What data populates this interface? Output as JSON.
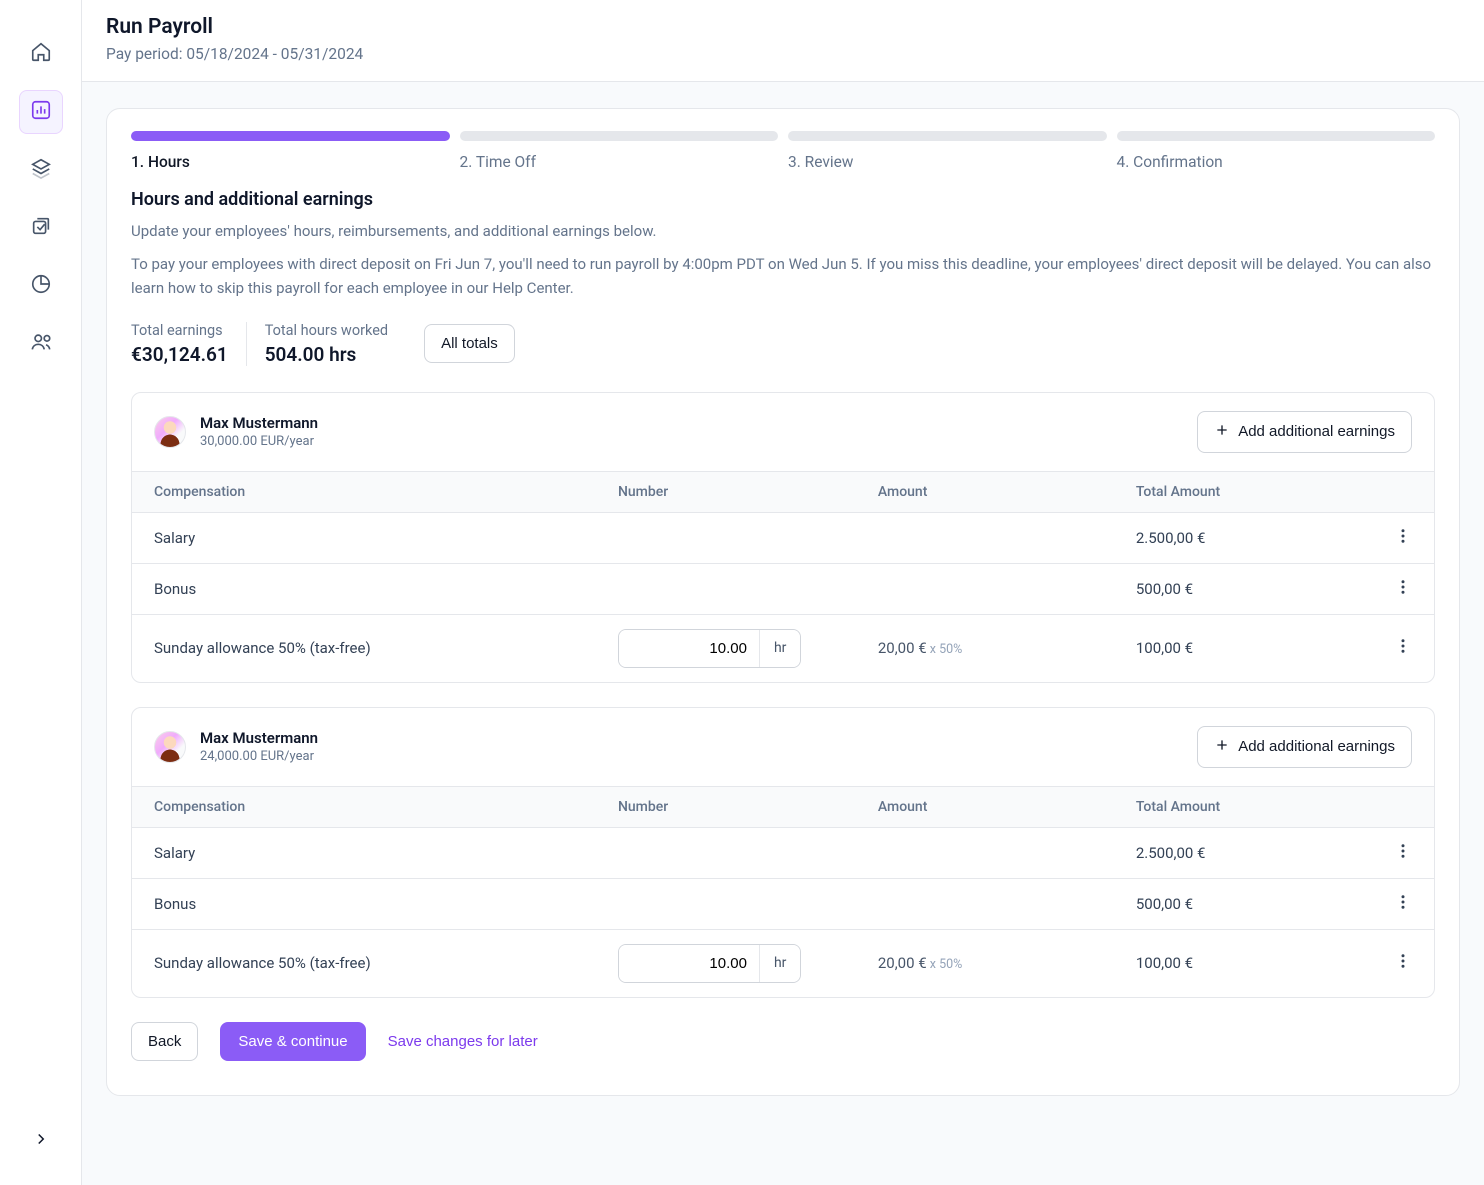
{
  "header": {
    "title": "Run Payroll",
    "subtitle": "Pay period: 05/18/2024 - 05/31/2024"
  },
  "steps": [
    {
      "label": "1. Hours",
      "active": true
    },
    {
      "label": "2. Time Off",
      "active": false
    },
    {
      "label": "3. Review",
      "active": false
    },
    {
      "label": "4. Confirmation",
      "active": false
    }
  ],
  "section": {
    "title": "Hours and additional earnings",
    "desc1": "Update your employees' hours, reimbursements, and additional earnings below.",
    "desc2": "To pay your employees with direct deposit on Fri Jun 7, you'll need to run payroll by 4:00pm PDT on Wed Jun 5. If you miss this deadline, your employees' direct deposit will be delayed. You can also learn how to skip this payroll for each employee in our Help Center."
  },
  "totals": {
    "earnings_label": "Total earnings",
    "earnings_value": "€30,124.61",
    "hours_label": "Total hours worked",
    "hours_value": "504.00 hrs",
    "all_totals_label": "All totals"
  },
  "columns": {
    "compensation": "Compensation",
    "number": "Number",
    "amount": "Amount",
    "total": "Total Amount"
  },
  "add_earnings_label": "Add additional earnings",
  "number_unit": "hr",
  "employees": [
    {
      "name": "Max Mustermann",
      "salary": "30,000.00 EUR/year",
      "rows": [
        {
          "label": "Salary",
          "number": "",
          "amount": "",
          "amount_suffix": "",
          "total": "2.500,00 €"
        },
        {
          "label": "Bonus",
          "number": "",
          "amount": "",
          "amount_suffix": "",
          "total": "500,00 €"
        },
        {
          "label": "Sunday allowance 50% (tax-free)",
          "number": "10.00",
          "amount": "20,00 €",
          "amount_suffix": " x 50%",
          "total": "100,00 €"
        }
      ]
    },
    {
      "name": "Max Mustermann",
      "salary": "24,000.00 EUR/year",
      "rows": [
        {
          "label": "Salary",
          "number": "",
          "amount": "",
          "amount_suffix": "",
          "total": "2.500,00 €"
        },
        {
          "label": "Bonus",
          "number": "",
          "amount": "",
          "amount_suffix": "",
          "total": "500,00 €"
        },
        {
          "label": "Sunday allowance 50% (tax-free)",
          "number": "10.00",
          "amount": "20,00 €",
          "amount_suffix": " x 50%",
          "total": "100,00 €"
        }
      ]
    }
  ],
  "footer": {
    "back": "Back",
    "save_continue": "Save & continue",
    "save_later": "Save changes for later"
  }
}
